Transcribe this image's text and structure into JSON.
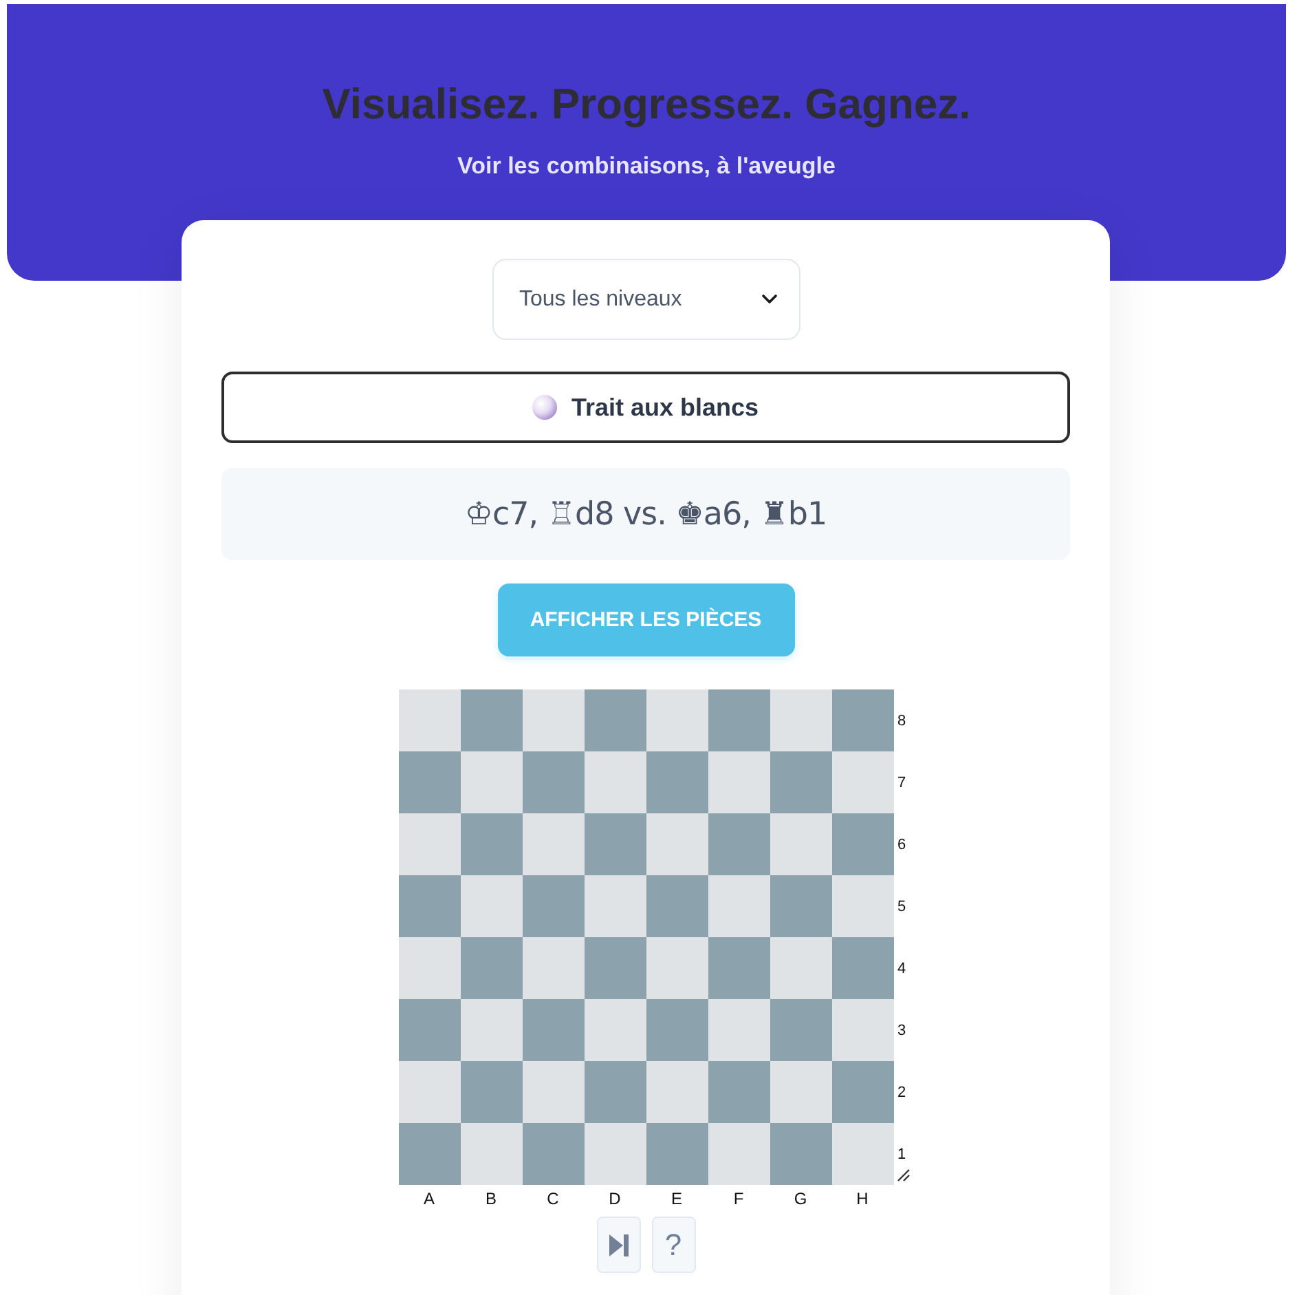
{
  "header": {
    "title": "Visualisez. Progressez. Gagnez.",
    "subtitle": "Voir les combinaisons, à l'aveugle"
  },
  "level_select": {
    "value": "Tous les niveaux"
  },
  "turn": {
    "label": "Trait aux blancs"
  },
  "position": {
    "text": "♔c7, ♖d8 vs. ♚a6, ♜b1"
  },
  "show_pieces_button": {
    "label": "AFFICHER LES PIÈCES"
  },
  "board": {
    "ranks": [
      "8",
      "7",
      "6",
      "5",
      "4",
      "3",
      "2",
      "1"
    ],
    "files": [
      "A",
      "B",
      "C",
      "D",
      "E",
      "F",
      "G",
      "H"
    ]
  },
  "controls": [
    {
      "kind": "skip"
    },
    {
      "kind": "help",
      "label": "?"
    }
  ]
}
